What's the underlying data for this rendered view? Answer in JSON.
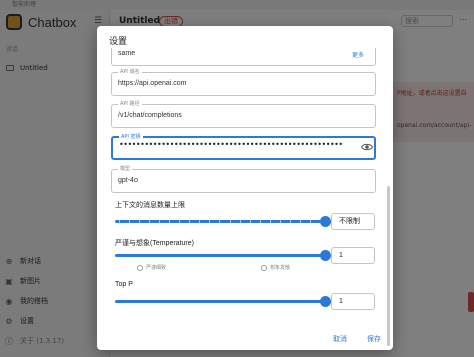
{
  "window": {
    "title": "智能助理"
  },
  "sidebar": {
    "brand": "Chatbox",
    "section_label": "对话",
    "chat_item": "Untitled",
    "menu": [
      {
        "label": "新对话",
        "icon": "plus-circle-icon"
      },
      {
        "label": "新图片",
        "icon": "image-icon"
      },
      {
        "label": "我的搭档",
        "icon": "partners-icon"
      },
      {
        "label": "设置",
        "icon": "gear-icon"
      },
      {
        "label": "关于 (1.3.17)",
        "icon": "info-icon"
      }
    ]
  },
  "main": {
    "title": "Untitled",
    "badge": "出错",
    "search_placeholder": "搜索",
    "error_text": "P地址，或者点击这设置自",
    "error_url": "openai.com/account/api-"
  },
  "dialog": {
    "title": "设置",
    "fields": {
      "provider": {
        "value": "same",
        "link": "更多"
      },
      "api_host": {
        "label": "API 域名",
        "value": "https://api.openai.com"
      },
      "api_path": {
        "label": "API 路径",
        "value": "/v1/chat/completions"
      },
      "api_key": {
        "label": "API 密钥",
        "value": "••••••••••••••••••••••••••••••••••••••••••••••••••••••••••••••"
      },
      "model": {
        "label": "模型",
        "value": "gpt-4o"
      }
    },
    "context_limit": {
      "label": "上下文的消息数量上限",
      "value": "不限制",
      "level": 1.0
    },
    "temperature": {
      "label": "严谨与想象(Temperature)",
      "value": "1",
      "hint_left": "严谨细致",
      "hint_right": "想象发散",
      "level": 1.0
    },
    "top_p": {
      "label": "Top P",
      "value": "1",
      "level": 1.0
    },
    "buttons": {
      "cancel": "取消",
      "save": "保存"
    }
  },
  "colors": {
    "accent": "#2a7ad6",
    "error": "#d9534f",
    "brand": "#e3a43a"
  }
}
